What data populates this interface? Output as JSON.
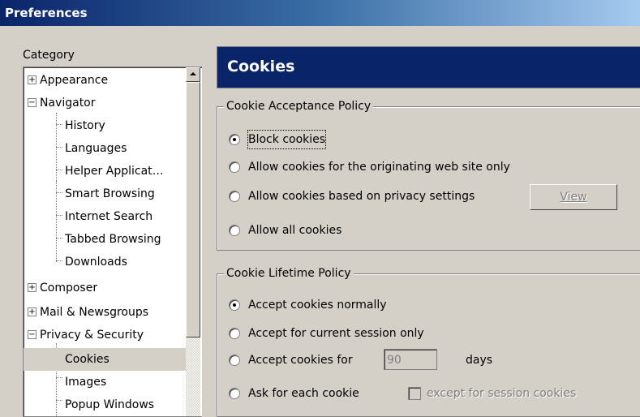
{
  "window": {
    "title": "Preferences"
  },
  "sidebar": {
    "label": "Category",
    "items": [
      {
        "label": "Appearance",
        "expander": "+"
      },
      {
        "label": "Navigator",
        "expander": "−"
      },
      {
        "label": "History"
      },
      {
        "label": "Languages"
      },
      {
        "label": "Helper Applicat…"
      },
      {
        "label": "Smart Browsing"
      },
      {
        "label": "Internet Search"
      },
      {
        "label": "Tabbed Browsing"
      },
      {
        "label": "Downloads"
      },
      {
        "label": "Composer",
        "expander": "+"
      },
      {
        "label": "Mail & Newsgroups",
        "expander": "+"
      },
      {
        "label": "Privacy & Security",
        "expander": "−"
      },
      {
        "label": "Cookies",
        "selected": true
      },
      {
        "label": "Images"
      },
      {
        "label": "Popup Windows"
      }
    ]
  },
  "panel": {
    "title": "Cookies",
    "acceptance": {
      "legend": "Cookie Acceptance Policy",
      "options": [
        "Block cookies",
        "Allow cookies for the originating web site only",
        "Allow cookies based on privacy settings",
        "Allow all cookies"
      ],
      "selected_index": 0,
      "view_button": "View"
    },
    "lifetime": {
      "legend": "Cookie Lifetime Policy",
      "options": [
        "Accept cookies normally",
        "Accept for current session only",
        "Accept cookies for",
        "Ask for each cookie"
      ],
      "selected_index": 0,
      "days_value": "90",
      "days_label": "days",
      "except_label": "except for session cookies"
    }
  }
}
